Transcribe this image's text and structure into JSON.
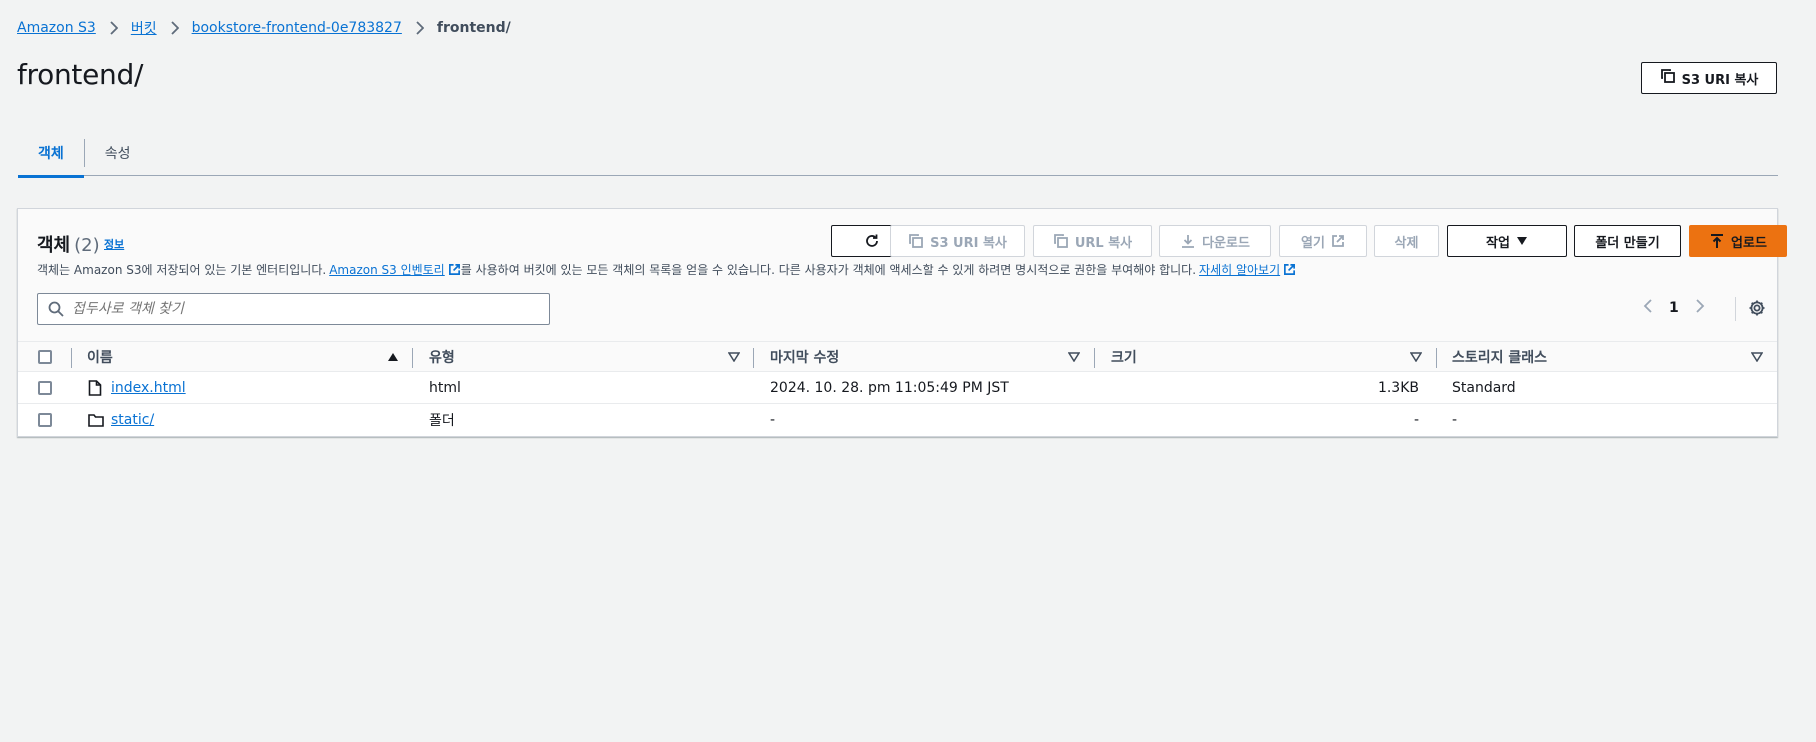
{
  "breadcrumb": {
    "items": [
      "Amazon S3",
      "버킷",
      "bookstore-frontend-0e783827"
    ],
    "current": "frontend/"
  },
  "page_title": "frontend/",
  "copy_uri_top_label": "S3 URI 복사",
  "tabs": [
    {
      "label": "객체",
      "active": true
    },
    {
      "label": "속성",
      "active": false
    }
  ],
  "panel": {
    "title": "객체",
    "count": "(2)",
    "info": "정보",
    "desc_prefix": "객체는 Amazon S3에 저장되어 있는 기본 엔터티입니다.",
    "desc_link1": "Amazon S3 인벤토리",
    "desc_middle": "를 사용하여 버킷에 있는 모든 객체의 목록을 얻을 수 있습니다. 다른 사용자가 객체에 액세스할 수 있게 하려면 명시적으로 권한을 부여해야 합니다.",
    "desc_link2": "자세히 알아보기"
  },
  "actions": {
    "copy_s3_uri": "S3 URI 복사",
    "copy_url": "URL 복사",
    "download": "다운로드",
    "open": "열기",
    "delete": "삭제",
    "actions": "작업",
    "create_folder": "폴더 만들기",
    "upload": "업로드"
  },
  "search": {
    "placeholder": "접두사로 객체 찾기"
  },
  "pagination": {
    "page": "1"
  },
  "table": {
    "columns": [
      "이름",
      "유형",
      "마지막 수정",
      "크기",
      "스토리지 클래스"
    ],
    "rows": [
      {
        "name": "index.html",
        "icon": "file-icon",
        "type": "html",
        "modified": "2024. 10. 28. pm 11:05:49 PM JST",
        "size": "1.3KB",
        "storage": "Standard"
      },
      {
        "name": "static/",
        "icon": "folder-icon",
        "type": "폴더",
        "modified": "-",
        "size": "-",
        "storage": "-"
      }
    ]
  },
  "colors": {
    "accent": "#0972d3",
    "primary_button": "#ec7211",
    "background": "#f2f3f3"
  }
}
